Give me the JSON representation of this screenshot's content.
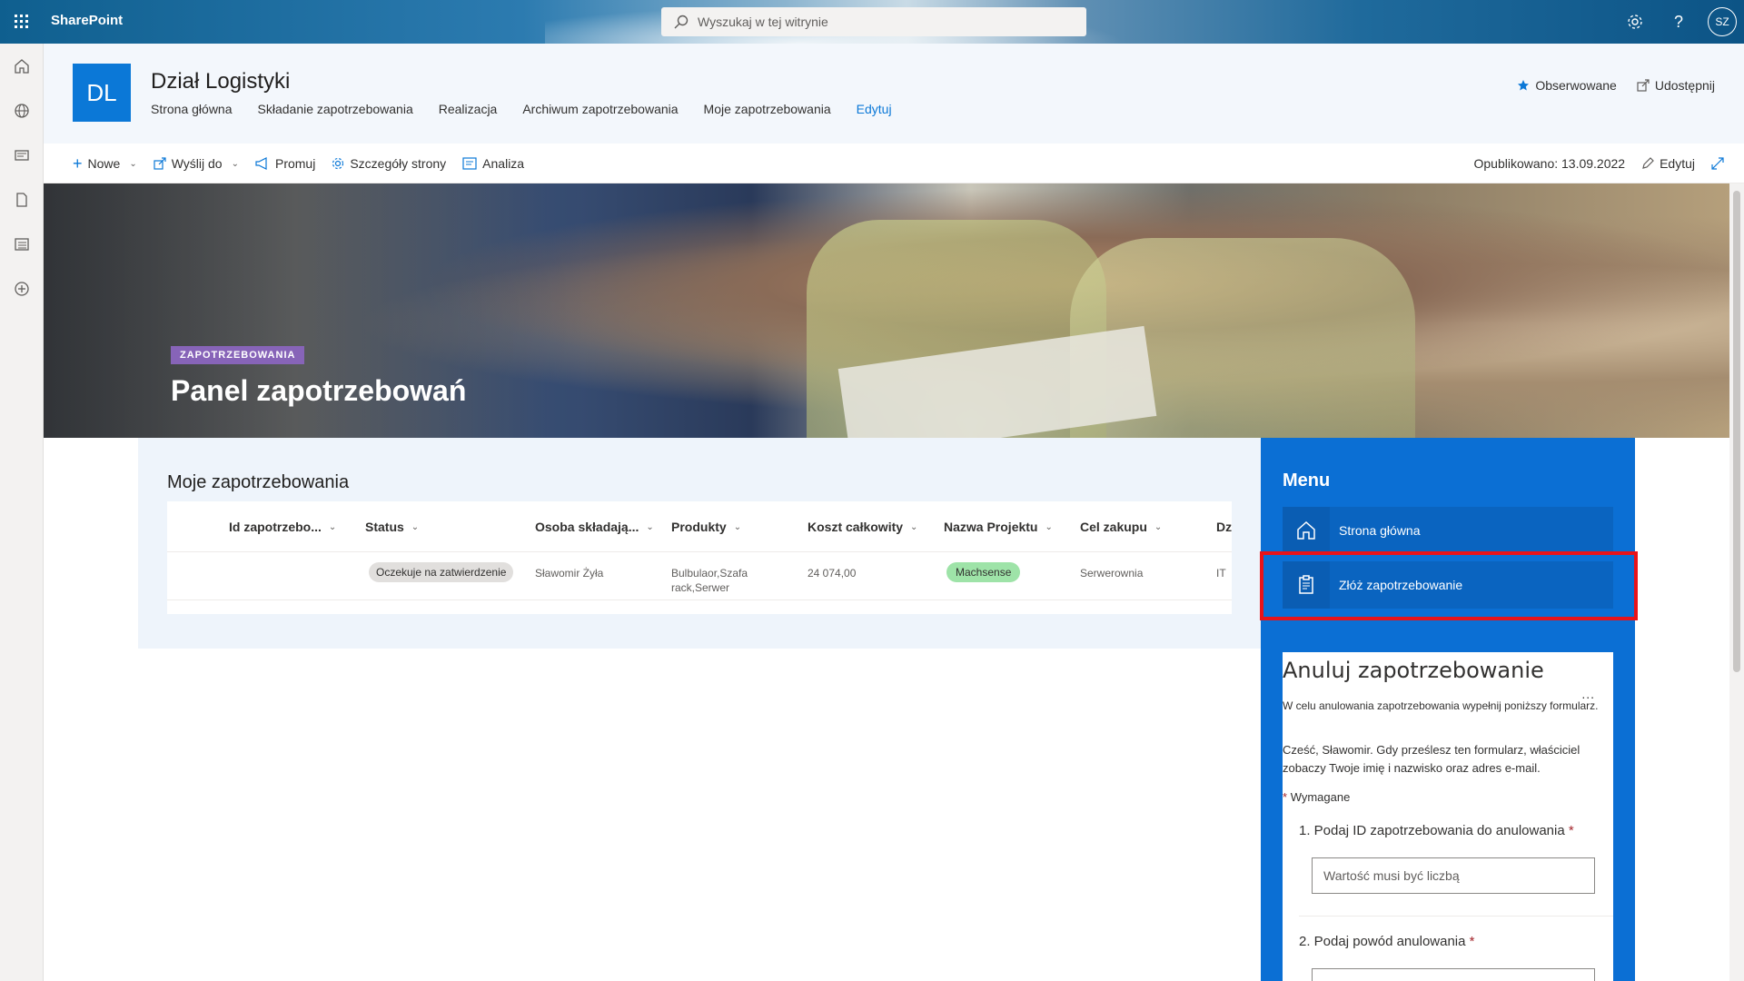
{
  "suite": {
    "brand": "SharePoint",
    "search_placeholder": "Wyszukaj w tej witrynie",
    "avatar_initials": "SZ"
  },
  "site": {
    "logo": "DL",
    "title": "Dział Logistyki",
    "nav": [
      "Strona główna",
      "Składanie zapotrzebowania",
      "Realizacja",
      "Archiwum zapotrzebowania",
      "Moje zapotrzebowania"
    ],
    "nav_edit": "Edytuj",
    "follow": "Obserwowane",
    "share": "Udostępnij"
  },
  "commandbar": {
    "new": "Nowe",
    "send_to": "Wyślij do",
    "promote": "Promuj",
    "page_details": "Szczegóły strony",
    "analytics": "Analiza",
    "published": "Opublikowano: 13.09.2022",
    "edit": "Edytuj"
  },
  "hero": {
    "topic": "ZAPOTRZEBOWANIA",
    "title": "Panel zapotrzebowań"
  },
  "list": {
    "title": "Moje zapotrzebowania",
    "columns": [
      "Id zapotrzebo...",
      "Status",
      "Osoba składają...",
      "Produkty",
      "Koszt całkowity",
      "Nazwa Projektu",
      "Cel zakupu",
      "Dz"
    ],
    "rows": [
      {
        "id": "",
        "status": "Oczekuje na zatwierdzenie",
        "person": "Sławomir Żyła",
        "products_line1": "Bulbulaor,Szafa",
        "products_line2": "rack,Serwer",
        "cost": "24 074,00",
        "project": "Machsense",
        "purpose": "Serwerownia",
        "dept": "IT"
      }
    ]
  },
  "menu": {
    "title": "Menu",
    "items": [
      {
        "label": "Strona główna",
        "icon": "home-icon"
      },
      {
        "label": "Złóż zapotrzebowanie",
        "icon": "clipboard-icon"
      }
    ]
  },
  "form": {
    "title": "Anuluj zapotrzebowanie",
    "more": "...",
    "description": "W celu anulowania zapotrzebowania wypełnij poniższy formularz.",
    "greeting": "Cześć, Sławomir. Gdy prześlesz ten formularz, właściciel zobaczy Twoje imię i nazwisko oraz adres e-mail.",
    "required_star": "*",
    "required_label": "Wymagane",
    "q1": "1. Podaj ID zapotrzebowania do anulowania",
    "q1_placeholder": "Wartość musi być liczbą",
    "q2": "2. Podaj powód anulowania"
  }
}
